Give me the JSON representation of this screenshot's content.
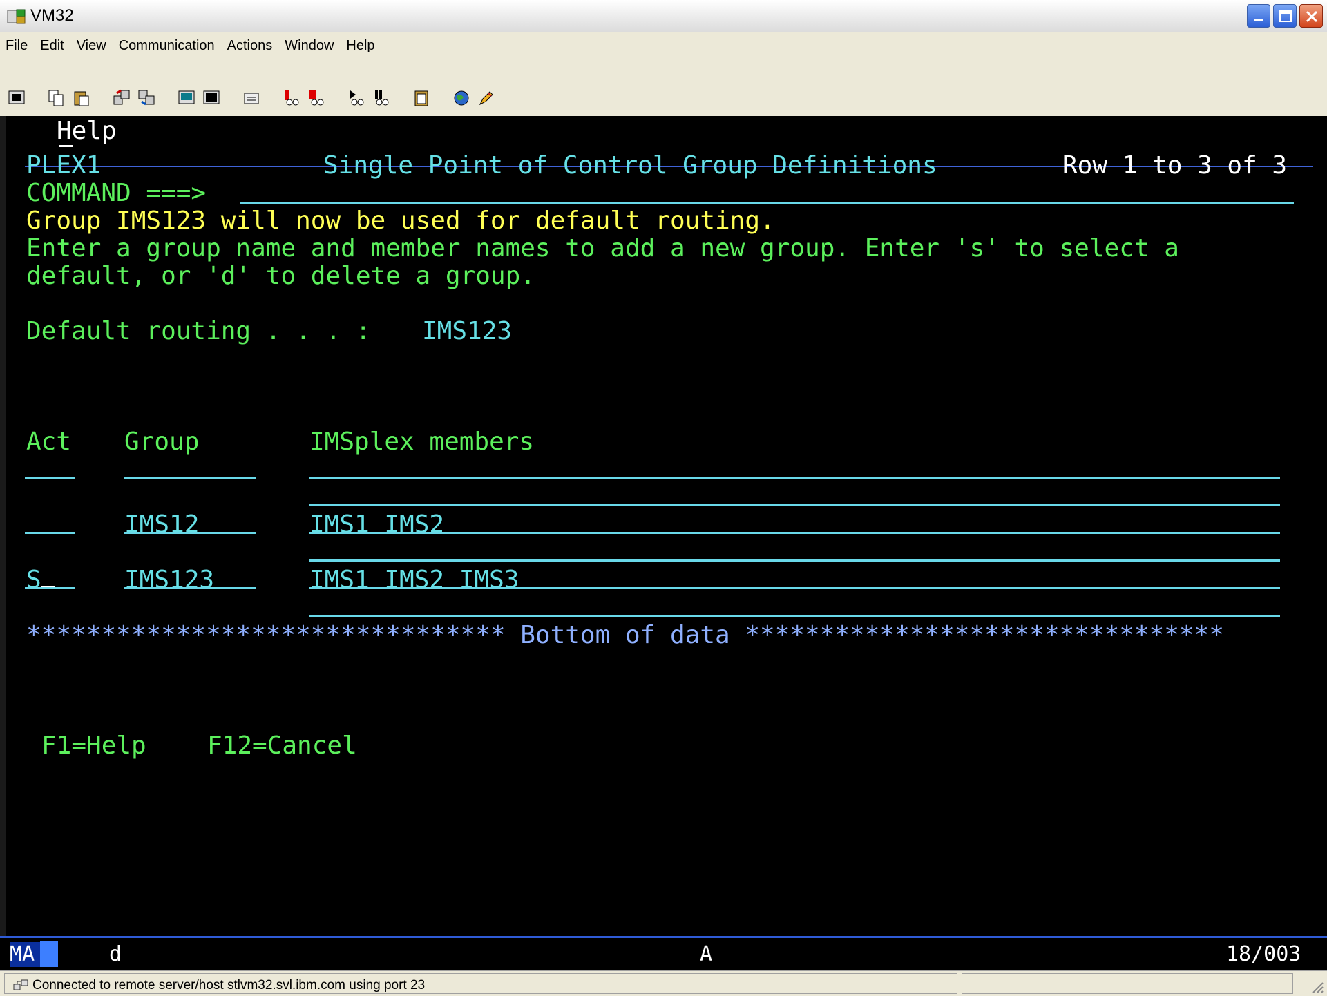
{
  "window": {
    "title": "VM32",
    "minimize_icon": "minimize-icon",
    "maximize_icon": "maximize-icon",
    "close_icon": "close-icon"
  },
  "menu": [
    "File",
    "Edit",
    "View",
    "Communication",
    "Actions",
    "Window",
    "Help"
  ],
  "toolbar_icons": [
    "session-icon",
    "copy-icon",
    "paste-icon",
    "send-file-icon",
    "receive-file-icon",
    "display-icon",
    "keypad-icon",
    "macro-icon",
    "record-macro-icon",
    "stop-macro-icon",
    "play-macro-icon",
    "pause-macro-icon",
    "clipboard-icon",
    "web-icon",
    "edit-icon"
  ],
  "terminal": {
    "menu_help": "Help",
    "plex": "PLEX1",
    "screen_title": "Single Point of Control Group Definitions",
    "row_info": "Row 1 to 3 of 3",
    "command_label": "COMMAND ===>",
    "message": "Group IMS123 will now be used for default routing.",
    "instructions_1": "Enter a group name and member names to add a new group. Enter 's' to select a",
    "instructions_2": "default, or 'd' to delete a group.",
    "default_routing_label": "Default routing . . . :",
    "default_routing_value": "IMS123",
    "columns": {
      "act": "Act",
      "group": "Group",
      "members": "IMSplex members"
    },
    "rows": [
      {
        "act": "",
        "group": "IMS12",
        "members": "IMS1 IMS2"
      },
      {
        "act": "S",
        "group": "IMS123",
        "members": "IMS1 IMS2 IMS3"
      }
    ],
    "bottom_marker": "******************************** Bottom of data ********************************",
    "fkeys": [
      "F1=Help",
      "F12=Cancel"
    ]
  },
  "oia": {
    "mode": "MA",
    "left": "d",
    "center": "A",
    "position": "18/003"
  },
  "status": {
    "text": "Connected to remote server/host stlvm32.svl.ibm.com using port 23"
  },
  "colors": {
    "terminal_bg": "#000000",
    "cyan": "#66e0e6",
    "green": "#5cf05c",
    "yellow": "#ffff55",
    "blue": "#8fb0ff"
  }
}
